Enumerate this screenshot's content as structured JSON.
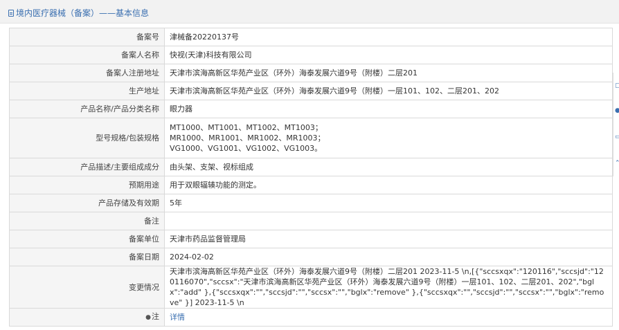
{
  "header": {
    "title": "境内医疗器械（备案）——基本信息"
  },
  "rows": [
    {
      "label": "备案号",
      "value": "津械备20220137号"
    },
    {
      "label": "备案人名称",
      "value": "快视(天津)科技有限公司"
    },
    {
      "label": "备案人注册地址",
      "value": "天津市滨海高新区华苑产业区（环外）海泰发展六道9号（附楼）二层201"
    },
    {
      "label": "生产地址",
      "value": "天津市滨海高新区华苑产业区（环外）海泰发展六道9号（附楼）一层101、102、二层201、202"
    },
    {
      "label": "产品名称/产品分类名称",
      "value": "眼力器"
    },
    {
      "label": "型号规格/包装规格",
      "lines": [
        "MT1000、MT1001、MT1002、MT1003；",
        "MR1000、MR1001、MR1002、MR1003；",
        "VG1000、VG1001、VG1002、VG1003。"
      ]
    },
    {
      "label": "产品描述/主要组成成分",
      "value": "由头架、支架、视标组成"
    },
    {
      "label": "预期用途",
      "value": "用于双眼辐辏功能的测定。"
    },
    {
      "label": "产品存储及有效期",
      "value": "5年"
    },
    {
      "label": "备注",
      "value": ""
    },
    {
      "label": "备案单位",
      "value": "天津市药品监督管理局"
    },
    {
      "label": "备案日期",
      "value": "2024-02-02"
    },
    {
      "label": "变更情况",
      "value": "天津市滨海高新区华苑产业区（环外）海泰发展六道9号（附楼）二层201 2023-11-5 \\n,[{\"sccsxqx\":\"120116\",\"sccsjd\":\"120116070\",\"sccsx\":\"天津市滨海高新区华苑产业区（环外）海泰发展六道9号（附楼）一层101、102、二层201、202\",\"bglx\":\"add\" },{\"sccsxqx\":\"\",\"sccsjd\":\"\",\"sccsx\":\"\",\"bglx\":\"remove\" },{\"sccsxqx\":\"\",\"sccsjd\":\"\",\"sccsx\":\"\",\"bglx\":\"remove\" }] 2023-11-5 \\n"
    },
    {
      "label": "注",
      "value": "详情",
      "icon": "pin-icon"
    }
  ],
  "colors": {
    "accent": "#3a6fb0",
    "label_bg": "#f5f5f5",
    "border": "#d9d9d9",
    "header_bg": "#f2f2f2"
  }
}
